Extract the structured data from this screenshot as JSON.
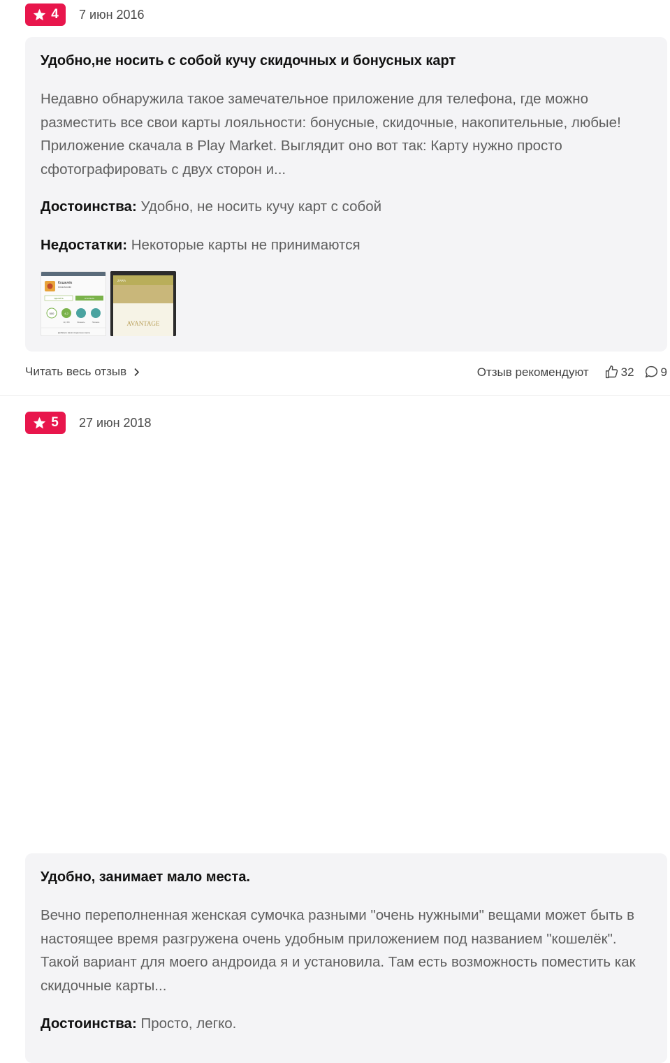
{
  "reviews": [
    {
      "rating": "4",
      "date": "7 июн 2016",
      "title": "Удобно,не носить с собой кучу скидочных и бонусных карт",
      "text": "Недавно обнаружила такое замечательное приложение для телефона, где можно разместить все свои карты лояльности: бонусные, скидочные, накопительные, любые! Приложение скачала в Play Market. Выглядит оно вот так: Карту нужно просто сфотографировать с двух сторон и...",
      "pros_label": "Достоинства:",
      "pros": "Удобно, не носить кучу карт с собой",
      "cons_label": "Недостатки:",
      "cons": "Некоторые карты не принимаются",
      "read_all": "Читать весь отзыв",
      "recommend": "Отзыв рекомендуют",
      "likes": "32",
      "comments": "9",
      "photo1": {
        "app_name": "Кошелёк",
        "developer": "DealsMobile",
        "btn_remove": "УДАЛИТЬ",
        "btn_open": "ОТКРЫТЬ",
        "stat_downloads": "500",
        "stat_rating": "4,2",
        "stat_size": "11,6 Мб",
        "stat_category": "Финансы",
        "stat_similar": "Похожие",
        "footer": "Добавьте ваши скидочные карты"
      },
      "photo2": {
        "header": "ZARA",
        "brand": "AVANTAGE"
      }
    },
    {
      "rating": "5",
      "date": "27 июн 2018",
      "title": "Удобно, занимает мало места.",
      "text": "Вечно переполненная женская сумочка разными \"очень нужными\" вещами может быть в настоящее время разгружена очень удобным приложением под названием \"кошелёк\". Такой вариант для моего андроида я и установила. Там есть возможность поместить как скидочные карты...",
      "pros_label": "Достоинства:",
      "pros": "Просто, легко."
    }
  ],
  "icons": {
    "star": "star-icon",
    "like": "thumbs-up-icon",
    "comment": "comment-icon",
    "chevron": "chevron-right-icon"
  },
  "colors": {
    "badge": "#e8164c",
    "card": "#f4f4f6",
    "text": "#5f5f5f"
  }
}
